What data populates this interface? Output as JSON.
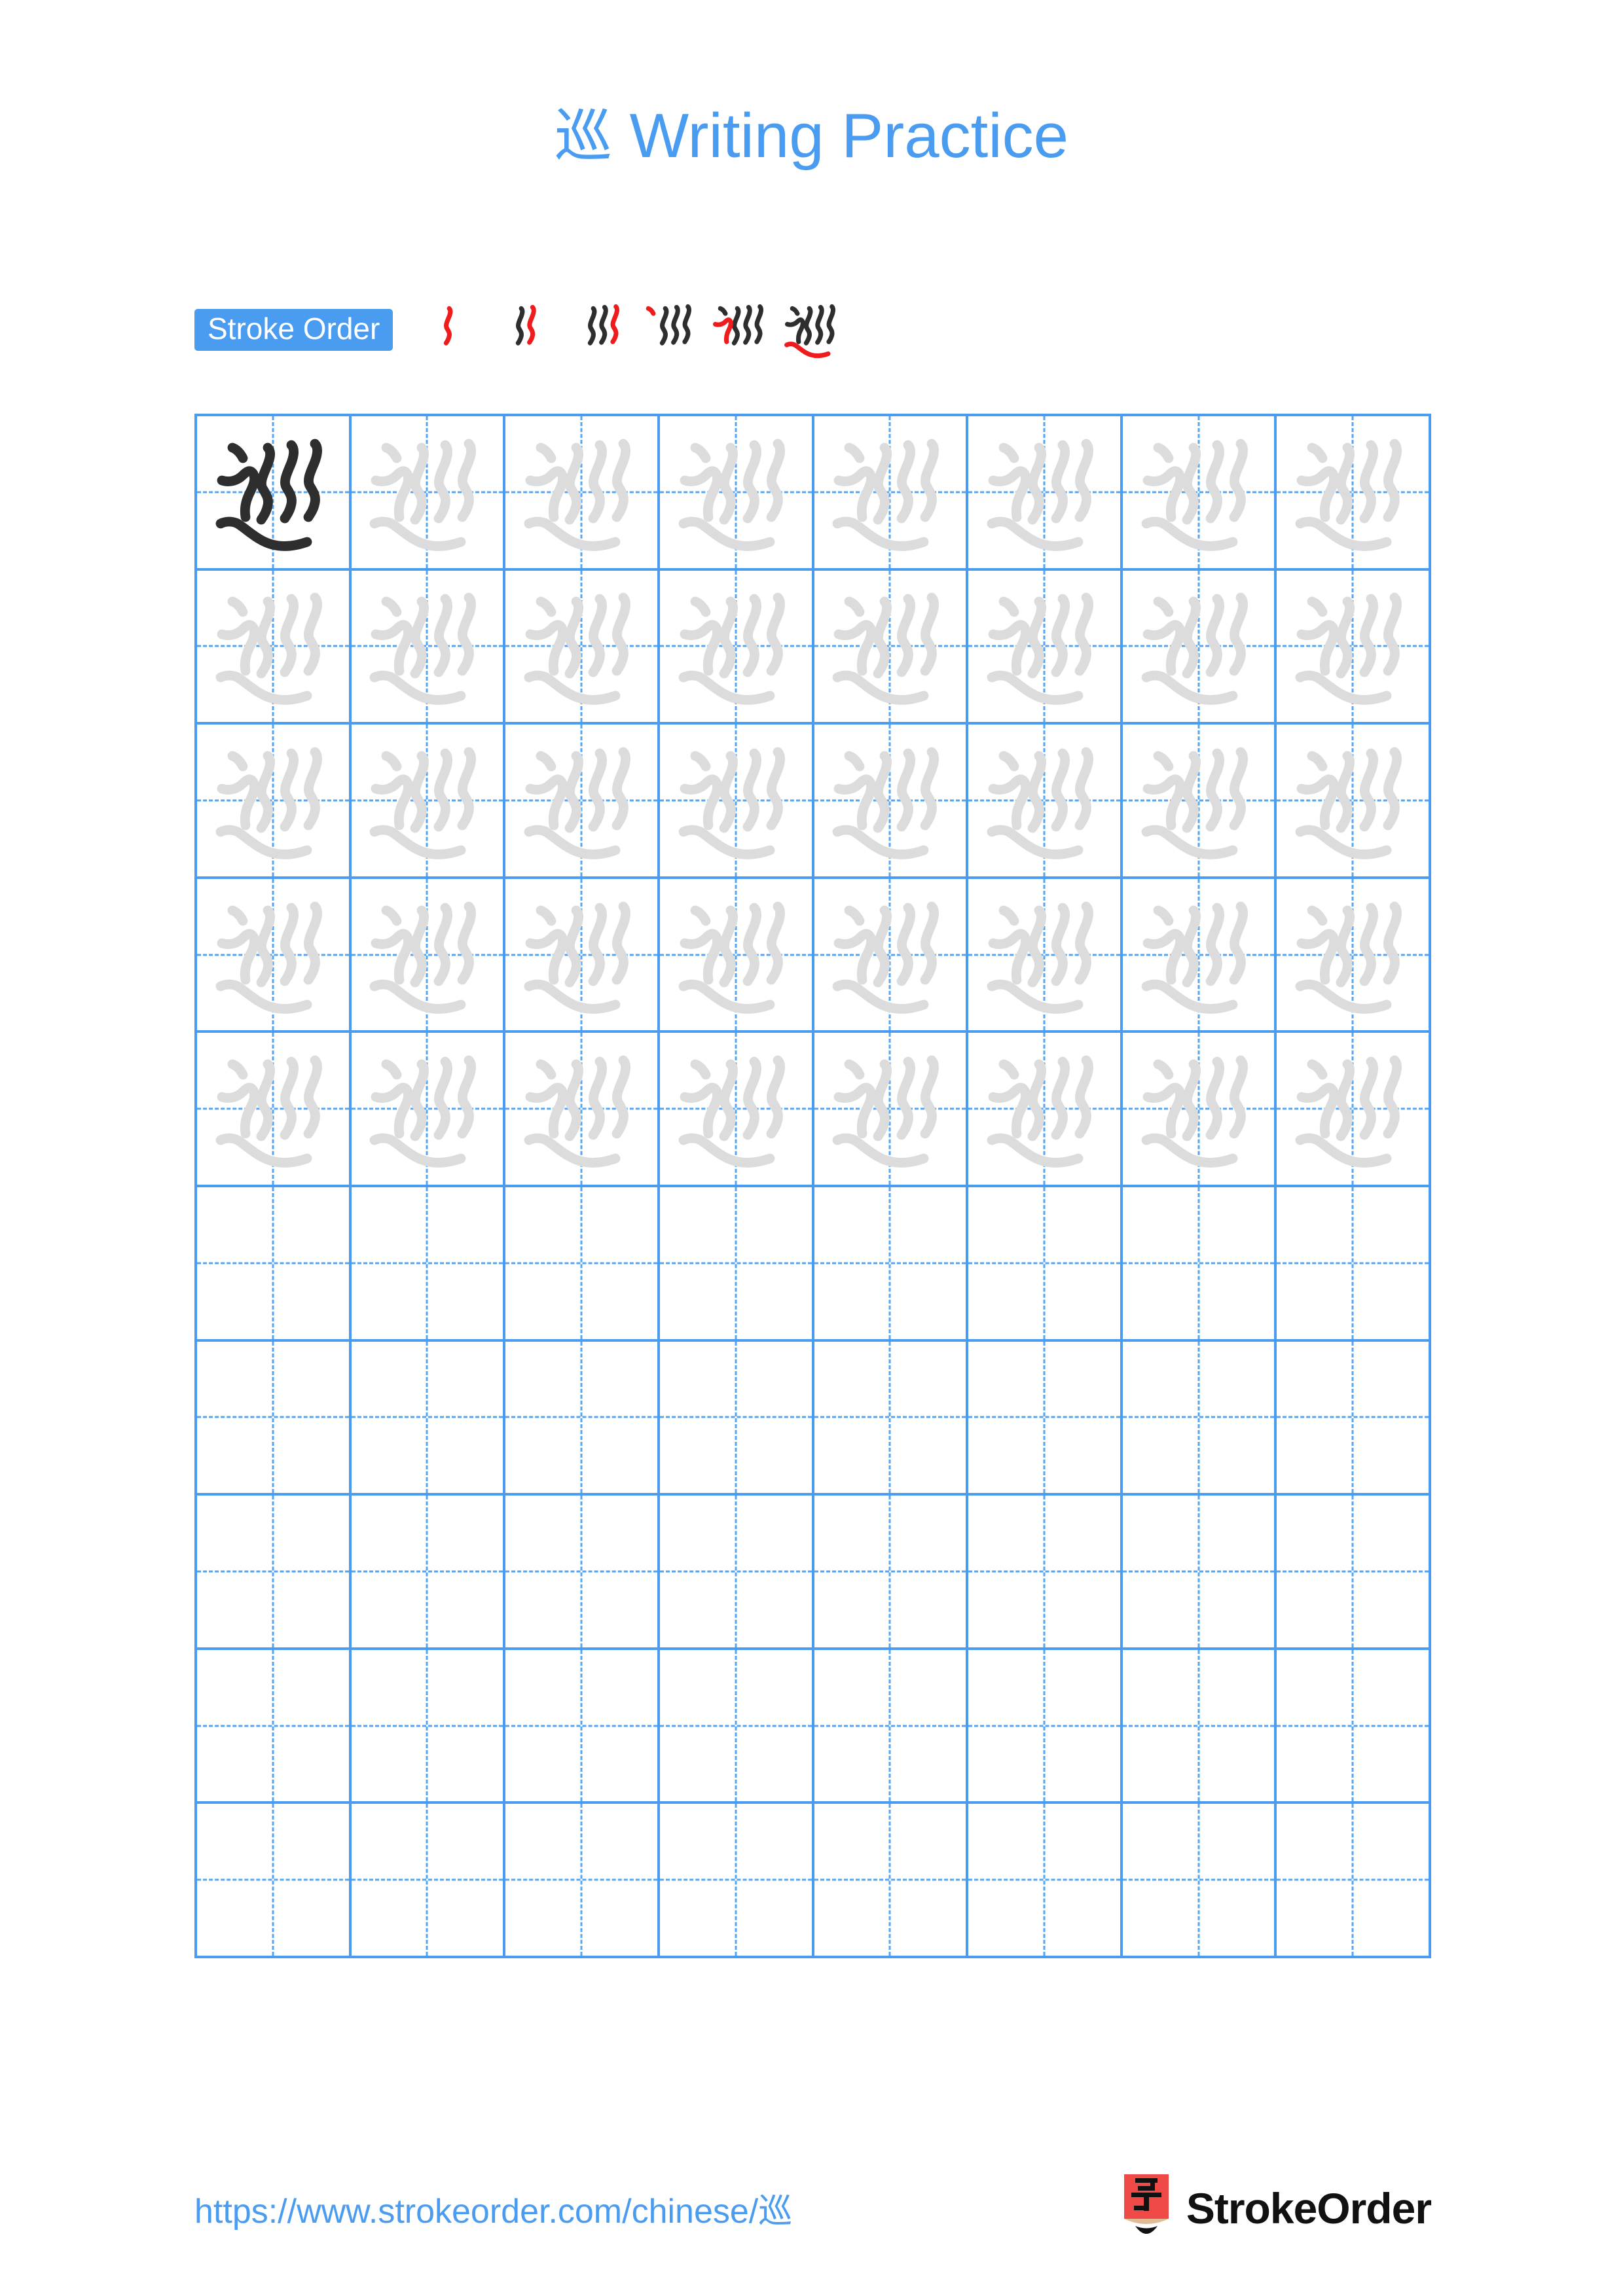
{
  "page": {
    "character": "巡",
    "title_suffix": "Writing Practice",
    "title_full": "巡 Writing Practice",
    "accent_color": "#4a9cf0",
    "grid_line_color": "#4a9cf0",
    "guide_line_color": "#55a5f2",
    "model_stroke_color": "#2e2e2e",
    "trace_stroke_color": "#dcdcdc",
    "new_stroke_color": "#ee1c1c",
    "background_color": "#ffffff"
  },
  "stroke_order": {
    "label": "Stroke Order",
    "total_strokes": 6,
    "steps": [
      {
        "index": 1,
        "name": "stroke-step-1",
        "strokes_shown": 1
      },
      {
        "index": 2,
        "name": "stroke-step-2",
        "strokes_shown": 2
      },
      {
        "index": 3,
        "name": "stroke-step-3",
        "strokes_shown": 3
      },
      {
        "index": 4,
        "name": "stroke-step-4",
        "strokes_shown": 4
      },
      {
        "index": 5,
        "name": "stroke-step-5",
        "strokes_shown": 5
      },
      {
        "index": 6,
        "name": "stroke-step-6",
        "strokes_shown": 6
      }
    ]
  },
  "grid": {
    "columns": 8,
    "rows": 10,
    "filled_rows": 5,
    "empty_rows": 5,
    "model_cell": {
      "row": 1,
      "column": 1
    }
  },
  "footer": {
    "url": "https://www.strokeorder.com/chinese/巡",
    "brand_name": "StrokeOrder",
    "brand_mark_character": "字",
    "brand_mark_body_color": "#f04a48",
    "brand_mark_wood_color": "#e0bb95",
    "brand_mark_tip_color": "#111111"
  }
}
